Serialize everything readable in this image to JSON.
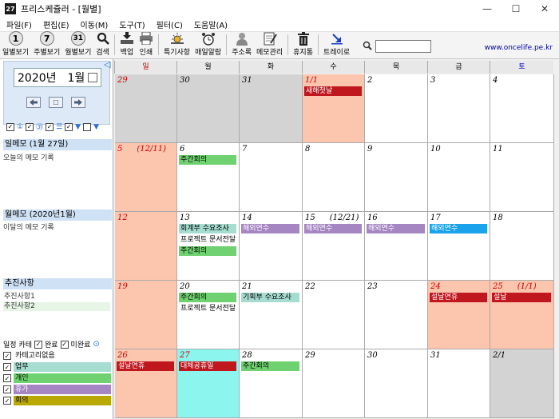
{
  "window": {
    "app_icon_text": "27",
    "title": "프리스케쥴러 - [월별]",
    "buttons": [
      "—",
      "☐",
      "✕"
    ]
  },
  "menu": [
    "파일(F)",
    "편집(E)",
    "이동(M)",
    "도구(T)",
    "필터(C)",
    "도움말(A)"
  ],
  "toolbar": {
    "day_view": {
      "num": "1",
      "label": "일별보기"
    },
    "week_view": {
      "num": "7",
      "label": "주별보기"
    },
    "month_view": {
      "num": "31",
      "label": "월별보기"
    },
    "search": {
      "label": "검색"
    },
    "backup": {
      "label": "백업"
    },
    "print": {
      "label": "인쇄"
    },
    "special": {
      "label": "특기사항"
    },
    "alarm": {
      "label": "매일알람"
    },
    "address": {
      "label": "주소록"
    },
    "memo": {
      "label": "메모관리"
    },
    "trash": {
      "label": "휴지통"
    },
    "tray": {
      "label": "트레이로"
    },
    "search_value": "",
    "site_url": "www.oncelife.pe.kr"
  },
  "left": {
    "month_year": "2020년",
    "month": "1월",
    "day_memo_header": "일메모 (1월 27일)",
    "day_memo_text": "오늘의 메모 기록",
    "month_memo_header": "월메모 (2020년1월)",
    "month_memo_text": "이달의 메모 기록",
    "tasks_header": "추진사항",
    "tasks": [
      {
        "label": "추진사항1",
        "bg": "#ffffff"
      },
      {
        "label": "추진사항2",
        "bg": "#e6f5e6"
      }
    ],
    "category_header": "일정 카테",
    "done_label": "완료",
    "undone_label": "미완료",
    "categories": [
      {
        "label": "카테고리없음",
        "bg": "#ffffff"
      },
      {
        "label": "업무",
        "bg": "#a6ddd0"
      },
      {
        "label": "개인",
        "bg": "#6fd16f"
      },
      {
        "label": "휴가",
        "bg": "#a585c2"
      },
      {
        "label": "회의",
        "bg": "#b8a800"
      }
    ]
  },
  "calendar": {
    "days_of_week": [
      {
        "label": "일",
        "color": "#cc0000"
      },
      {
        "label": "월",
        "color": "#000000"
      },
      {
        "label": "화",
        "color": "#000000"
      },
      {
        "label": "수",
        "color": "#000000"
      },
      {
        "label": "목",
        "color": "#000000"
      },
      {
        "label": "금",
        "color": "#000000"
      },
      {
        "label": "토",
        "color": "#0000cc"
      }
    ],
    "weeks": [
      [
        {
          "day": "29",
          "lunar": "",
          "bg": "#d3d3d3",
          "color": "#cc0000",
          "events": []
        },
        {
          "day": "30",
          "lunar": "",
          "bg": "#d3d3d3",
          "color": "#000000",
          "events": []
        },
        {
          "day": "31",
          "lunar": "",
          "bg": "#d3d3d3",
          "color": "#000000",
          "events": []
        },
        {
          "day": "1/1",
          "lunar": "",
          "bg": "#fcc5ae",
          "color": "#cc0000",
          "events": [
            {
              "text": "새해첫날",
              "bg": "#c0161e",
              "color": "#ffffff"
            }
          ]
        },
        {
          "day": "2",
          "lunar": "",
          "bg": "#ffffff",
          "color": "#000000",
          "events": []
        },
        {
          "day": "3",
          "lunar": "",
          "bg": "#ffffff",
          "color": "#000000",
          "events": []
        },
        {
          "day": "4",
          "lunar": "",
          "bg": "#ffffff",
          "color": "#000000",
          "events": []
        }
      ],
      [
        {
          "day": "5",
          "lunar": "(12/11)",
          "bg": "#fcc5ae",
          "color": "#cc0000",
          "events": []
        },
        {
          "day": "6",
          "lunar": "",
          "bg": "#ffffff",
          "color": "#000000",
          "events": [
            {
              "text": "주간회의",
              "bg": "#6fd16f",
              "color": "#000000"
            }
          ]
        },
        {
          "day": "7",
          "lunar": "",
          "bg": "#ffffff",
          "color": "#000000",
          "events": []
        },
        {
          "day": "8",
          "lunar": "",
          "bg": "#ffffff",
          "color": "#000000",
          "events": []
        },
        {
          "day": "9",
          "lunar": "",
          "bg": "#ffffff",
          "color": "#000000",
          "events": []
        },
        {
          "day": "10",
          "lunar": "",
          "bg": "#ffffff",
          "color": "#000000",
          "events": []
        },
        {
          "day": "11",
          "lunar": "",
          "bg": "#ffffff",
          "color": "#000000",
          "events": []
        }
      ],
      [
        {
          "day": "12",
          "lunar": "",
          "bg": "#fcc5ae",
          "color": "#cc0000",
          "events": []
        },
        {
          "day": "13",
          "lunar": "",
          "bg": "#ffffff",
          "color": "#000000",
          "events": [
            {
              "text": "회계부 수요조사",
              "bg": "#a6ddd0",
              "color": "#000000"
            },
            {
              "text": "프로젝트 문서전달",
              "bg": "#ffffff",
              "color": "#000000"
            },
            {
              "text": "주간회의",
              "bg": "#6fd16f",
              "color": "#000000"
            }
          ]
        },
        {
          "day": "14",
          "lunar": "",
          "bg": "#ffffff",
          "color": "#000000",
          "events": [
            {
              "text": "해외연수",
              "bg": "#a585c2",
              "color": "#ffffff"
            }
          ]
        },
        {
          "day": "15",
          "lunar": "(12/21)",
          "bg": "#ffffff",
          "color": "#000000",
          "events": [
            {
              "text": "해외연수",
              "bg": "#a585c2",
              "color": "#ffffff"
            }
          ]
        },
        {
          "day": "16",
          "lunar": "",
          "bg": "#ffffff",
          "color": "#000000",
          "events": [
            {
              "text": "해외연수",
              "bg": "#a585c2",
              "color": "#ffffff"
            }
          ]
        },
        {
          "day": "17",
          "lunar": "",
          "bg": "#ffffff",
          "color": "#000000",
          "events": [
            {
              "text": "해외연수",
              "bg": "#1aa3ea",
              "color": "#ffffff"
            }
          ]
        },
        {
          "day": "18",
          "lunar": "",
          "bg": "#ffffff",
          "color": "#000000",
          "events": []
        }
      ],
      [
        {
          "day": "19",
          "lunar": "",
          "bg": "#fcc5ae",
          "color": "#cc0000",
          "events": []
        },
        {
          "day": "20",
          "lunar": "",
          "bg": "#ffffff",
          "color": "#000000",
          "events": [
            {
              "text": "주간회의",
              "bg": "#6fd16f",
              "color": "#000000"
            },
            {
              "text": "프로젝트 문서전달",
              "bg": "#ffffff",
              "color": "#000000"
            }
          ]
        },
        {
          "day": "21",
          "lunar": "",
          "bg": "#ffffff",
          "color": "#000000",
          "events": [
            {
              "text": "기획부 수요조사",
              "bg": "#a6ddd0",
              "color": "#000000"
            }
          ]
        },
        {
          "day": "22",
          "lunar": "",
          "bg": "#ffffff",
          "color": "#000000",
          "events": []
        },
        {
          "day": "23",
          "lunar": "",
          "bg": "#ffffff",
          "color": "#000000",
          "events": []
        },
        {
          "day": "24",
          "lunar": "",
          "bg": "#fcc5ae",
          "color": "#cc0000",
          "events": [
            {
              "text": "설날연휴",
              "bg": "#c0161e",
              "color": "#ffffff"
            }
          ]
        },
        {
          "day": "25",
          "lunar": "(1/1)",
          "bg": "#fcc5ae",
          "color": "#cc0000",
          "events": [
            {
              "text": "설날",
              "bg": "#c0161e",
              "color": "#ffffff"
            }
          ]
        }
      ],
      [
        {
          "day": "26",
          "lunar": "",
          "bg": "#fcc5ae",
          "color": "#cc0000",
          "events": [
            {
              "text": "설날연휴",
              "bg": "#c0161e",
              "color": "#ffffff"
            }
          ]
        },
        {
          "day": "27",
          "lunar": "",
          "bg": "#8cf5ee",
          "color": "#cc0000",
          "events": [
            {
              "text": "대체공휴일",
              "bg": "#c0161e",
              "color": "#ffffff"
            }
          ]
        },
        {
          "day": "28",
          "lunar": "",
          "bg": "#ffffff",
          "color": "#000000",
          "events": [
            {
              "text": "주간회의",
              "bg": "#6fd16f",
              "color": "#000000"
            }
          ]
        },
        {
          "day": "29",
          "lunar": "",
          "bg": "#ffffff",
          "color": "#000000",
          "events": []
        },
        {
          "day": "30",
          "lunar": "",
          "bg": "#ffffff",
          "color": "#000000",
          "events": []
        },
        {
          "day": "31",
          "lunar": "",
          "bg": "#ffffff",
          "color": "#000000",
          "events": []
        },
        {
          "day": "2/1",
          "lunar": "",
          "bg": "#d3d3d3",
          "color": "#000000",
          "events": []
        }
      ]
    ]
  }
}
